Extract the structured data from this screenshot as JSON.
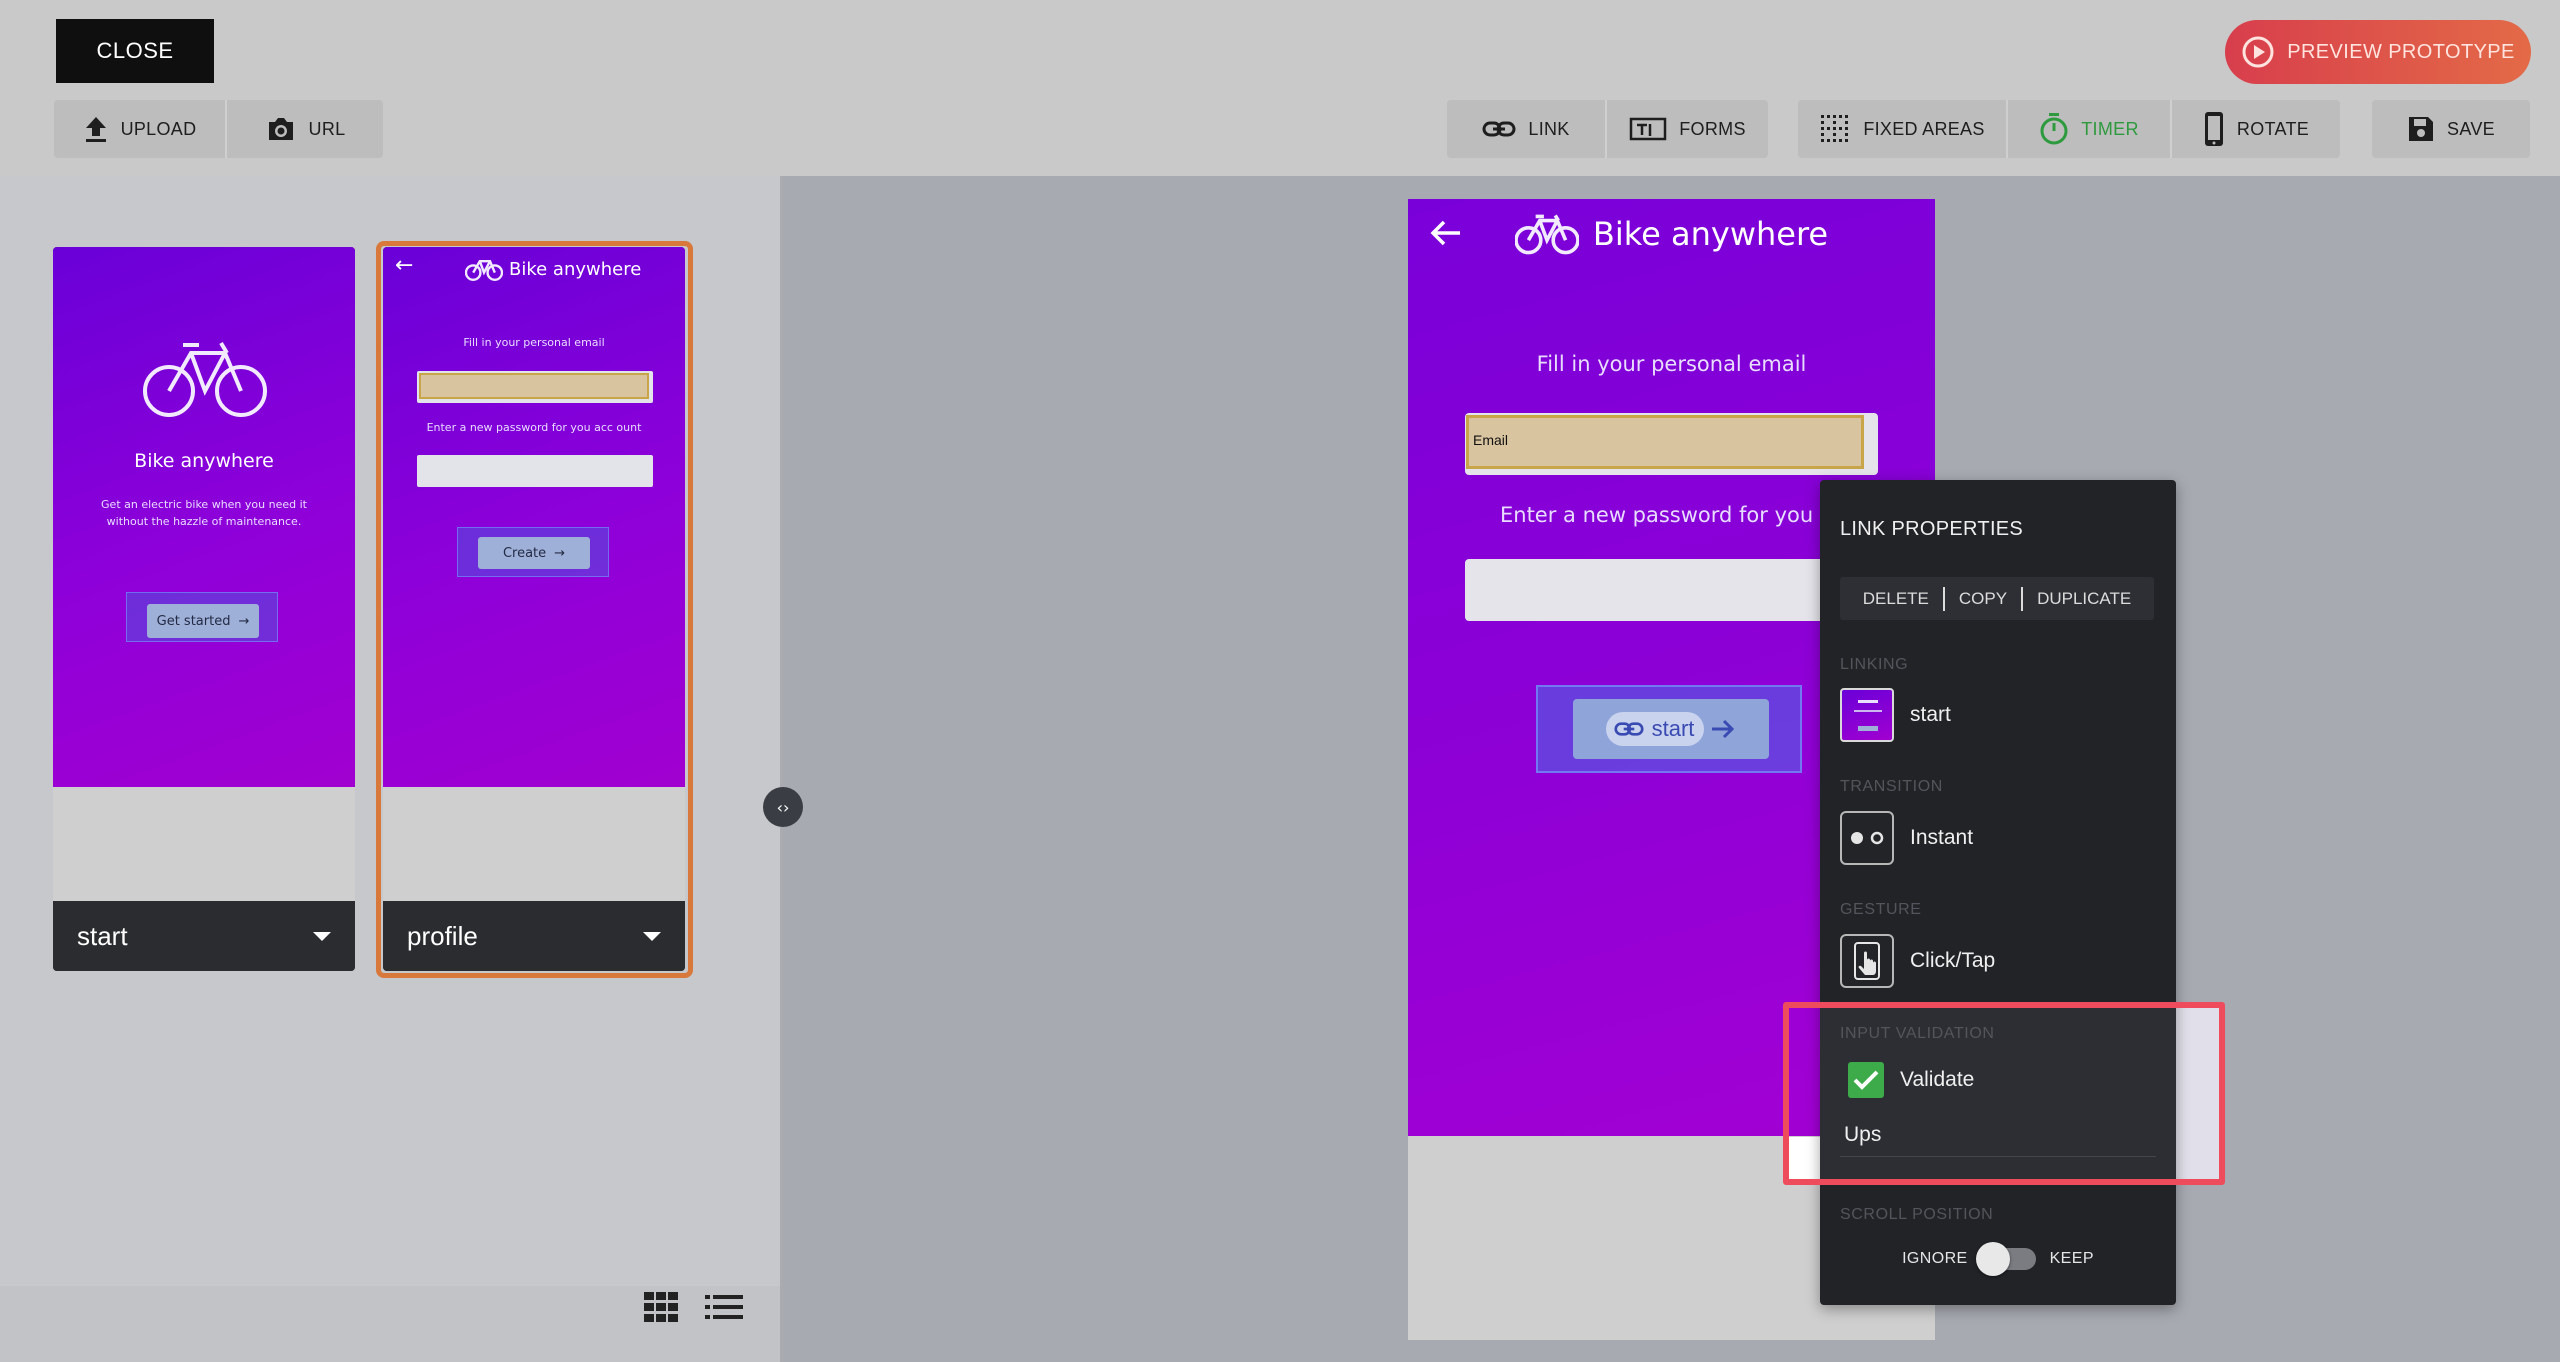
{
  "toolbar": {
    "close_label": "CLOSE",
    "upload_label": "UPLOAD",
    "url_label": "URL",
    "link_label": "LINK",
    "forms_label": "FORMS",
    "fixed_areas_label": "FIXED AREAS",
    "timer_label": "TIMER",
    "rotate_label": "ROTATE",
    "save_label": "SAVE",
    "preview_label": "PREVIEW PROTOTYPE"
  },
  "colors": {
    "accent_timer": "#2e9a3e",
    "preview_gradient_start": "#d83e4c",
    "selected_border": "#d8783a",
    "validation_highlight": "#ee4c5c",
    "checkbox_green": "#3dab49",
    "screen_purple": "#8c00d6"
  },
  "screens": [
    {
      "name": "start",
      "title": "Bike anywhere",
      "subtitle_line1": "Get an electric bike when you need it",
      "subtitle_line2": "without the hazzle of maintenance.",
      "button_label": "Get started"
    },
    {
      "name": "profile",
      "title": "Bike anywhere",
      "email_prompt": "Fill in your personal email",
      "password_prompt": "Enter a new password for you acc ount",
      "button_label": "Create"
    }
  ],
  "view_toggle": {
    "grid_icon": "grid-icon",
    "list_icon": "list-icon"
  },
  "prototype": {
    "title": "Bike anywhere",
    "email_prompt": "Fill in your personal email",
    "email_hotspot_text": "Email",
    "password_prompt": "Enter a new password for you acc ou",
    "link_chip_label": "start"
  },
  "link_properties": {
    "title": "LINK PROPERTIES",
    "actions": {
      "delete": "DELETE",
      "copy": "COPY",
      "duplicate": "DUPLICATE"
    },
    "linking_label": "LINKING",
    "linking_value": "start",
    "transition_label": "TRANSITION",
    "transition_value": "Instant",
    "gesture_label": "GESTURE",
    "gesture_value": "Click/Tap",
    "validation_label": "INPUT VALIDATION",
    "validate_label": "Validate",
    "validate_checked": true,
    "validation_message": "Ups",
    "scroll_label": "SCROLL POSITION",
    "scroll_ignore": "IGNORE",
    "scroll_keep": "KEEP"
  }
}
